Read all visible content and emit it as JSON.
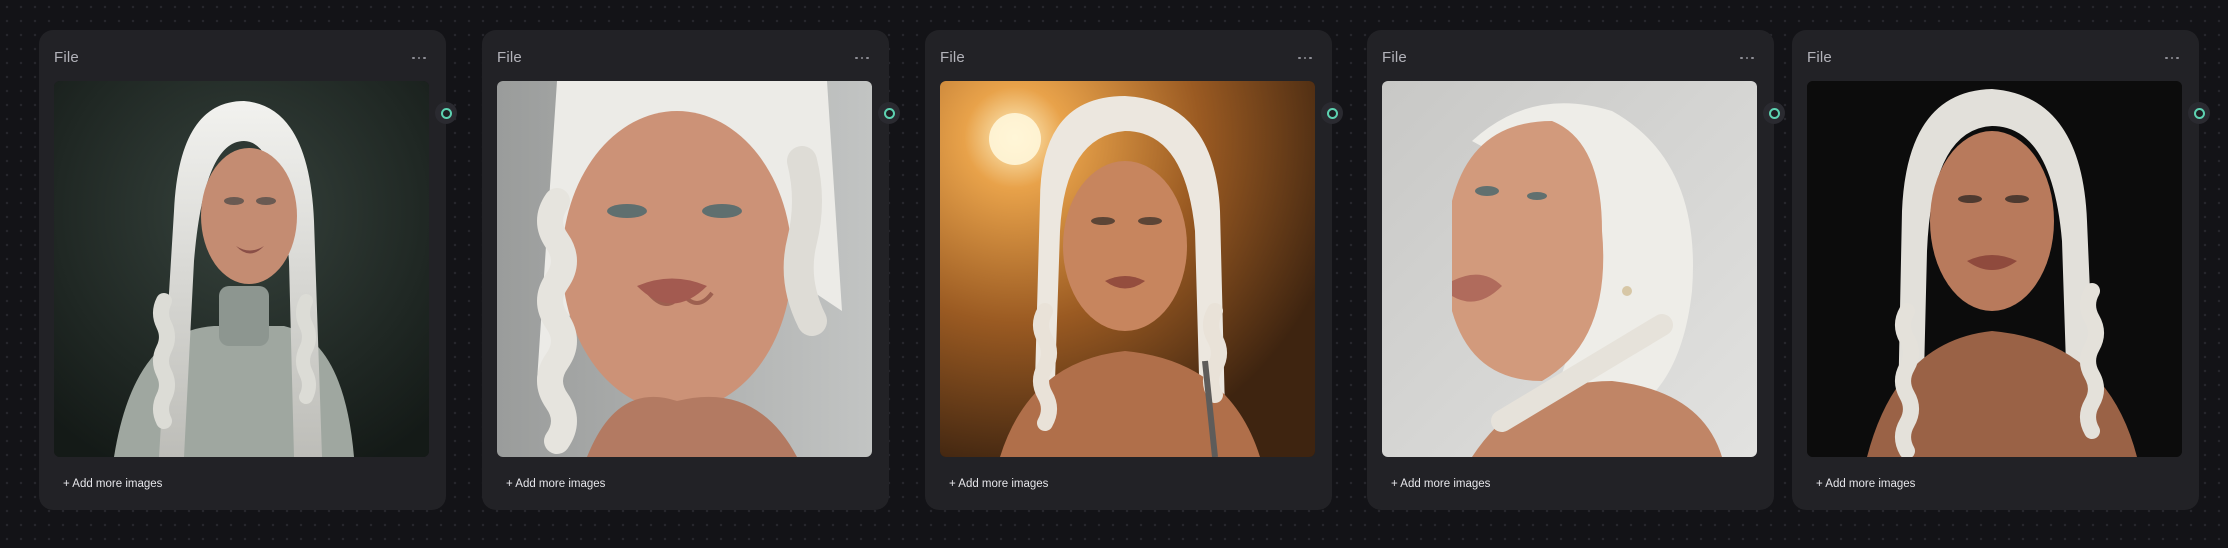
{
  "canvas": {
    "accent_color": "#5dd2b1",
    "background_color": "#131317"
  },
  "nodes": [
    {
      "title": "File",
      "menu_icon": "ellipsis-icon",
      "add_label": "+ Add more images",
      "portrait_tone": "dark-green backdrop"
    },
    {
      "title": "File",
      "menu_icon": "ellipsis-icon",
      "add_label": "+ Add more images",
      "portrait_tone": "grey backdrop close-up"
    },
    {
      "title": "File",
      "menu_icon": "ellipsis-icon",
      "add_label": "+ Add more images",
      "portrait_tone": "golden sunset field"
    },
    {
      "title": "File",
      "menu_icon": "ellipsis-icon",
      "add_label": "+ Add more images",
      "portrait_tone": "light grey profile"
    },
    {
      "title": "File",
      "menu_icon": "ellipsis-icon",
      "add_label": "+ Add more images",
      "portrait_tone": "black backdrop"
    }
  ]
}
